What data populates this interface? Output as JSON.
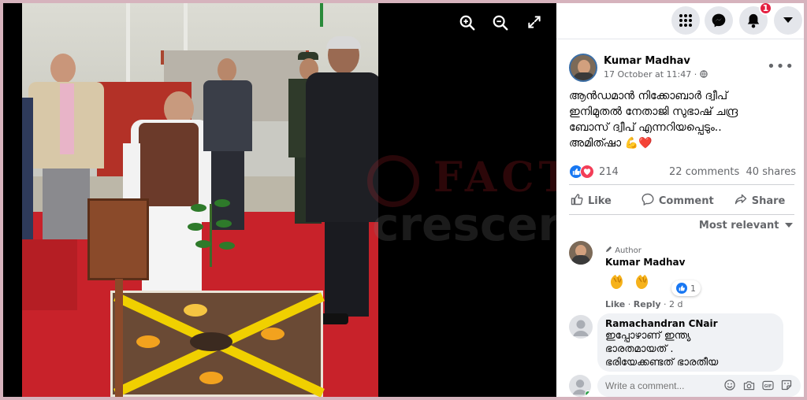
{
  "viewer": {
    "icons": [
      "zoom-in-icon",
      "zoom-out-icon",
      "fullscreen-icon"
    ],
    "watermark": {
      "top": "FACT",
      "bottom": "crescendo"
    }
  },
  "topnav": {
    "icons": [
      "menu-grid-icon",
      "messenger-icon",
      "bell-icon",
      "caret-down-icon"
    ],
    "notification_count": "1"
  },
  "post": {
    "author": "Kumar Madhav",
    "timestamp": "17 October at 11:47",
    "privacy_separator": "·",
    "text_lines": [
      "ആൻഡമാൻ നിക്കോബാർ ദ്വീപ്",
      "ഇനിമുതൽ നേതാജി സുഭാഷ് ചന്ദ്ര",
      "ബോസ് ദ്വീപ് എന്നറിയപ്പെടും..",
      "അമിത്ഷാ 💪❤️"
    ],
    "reaction_count": "214",
    "comments_count": "22 comments",
    "shares_count": "40 shares",
    "actions": {
      "like": "Like",
      "comment": "Comment",
      "share": "Share"
    },
    "sort_label": "Most relevant"
  },
  "comments": [
    {
      "tag": "Author",
      "name": "Kumar Madhav",
      "emoji": "👏👏",
      "reaction_count": "1",
      "like": "Like",
      "reply": "Reply",
      "age": "2 d"
    },
    {
      "name": "Ramachandran CNair",
      "text_lines": [
        "ഇപ്പോഴാണ് ഇന്ത്യ",
        "ഭാരതമായത് .",
        "ഭരിയേക്കണ്ടത് ഭാരതീയ"
      ]
    }
  ],
  "composer": {
    "placeholder": "Write a comment..."
  },
  "colors": {
    "facebook_blue": "#1877f2",
    "love_red": "#f33e58",
    "notification_red": "#e41e3f",
    "border_pink": "#d6b3bd"
  }
}
